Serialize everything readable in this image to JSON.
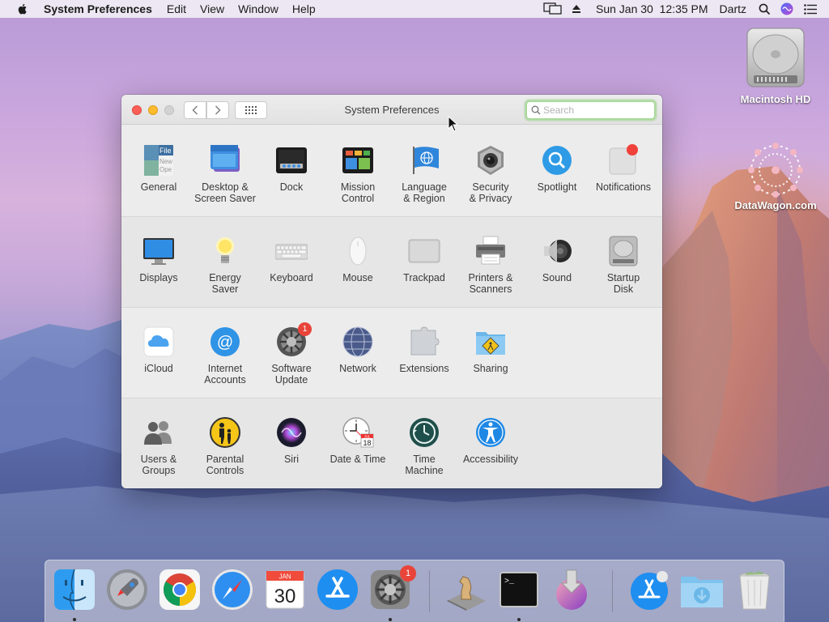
{
  "menubar": {
    "app_name": "System Preferences",
    "menus": [
      "Edit",
      "View",
      "Window",
      "Help"
    ],
    "clock": "Sun Jan 30  12:35 PM",
    "user": "Dartz"
  },
  "desktop": {
    "items": [
      {
        "label": "Macintosh HD",
        "icon": "hard-drive-icon"
      },
      {
        "label": "DataWagon.com",
        "icon": "datawagon-logo-icon"
      }
    ]
  },
  "window": {
    "title": "System Preferences",
    "search_placeholder": "Search",
    "sections": [
      {
        "panes": [
          {
            "label": "General",
            "icon": "general-icon"
          },
          {
            "label": "Desktop &\nScreen Saver",
            "icon": "desktop-screensaver-icon"
          },
          {
            "label": "Dock",
            "icon": "dock-icon"
          },
          {
            "label": "Mission\nControl",
            "icon": "mission-control-icon"
          },
          {
            "label": "Language\n& Region",
            "icon": "language-region-icon"
          },
          {
            "label": "Security\n& Privacy",
            "icon": "security-privacy-icon"
          },
          {
            "label": "Spotlight",
            "icon": "spotlight-icon"
          },
          {
            "label": "Notifications",
            "icon": "notifications-icon"
          }
        ]
      },
      {
        "panes": [
          {
            "label": "Displays",
            "icon": "displays-icon"
          },
          {
            "label": "Energy\nSaver",
            "icon": "energy-saver-icon"
          },
          {
            "label": "Keyboard",
            "icon": "keyboard-icon"
          },
          {
            "label": "Mouse",
            "icon": "mouse-icon"
          },
          {
            "label": "Trackpad",
            "icon": "trackpad-icon"
          },
          {
            "label": "Printers &\nScanners",
            "icon": "printers-scanners-icon"
          },
          {
            "label": "Sound",
            "icon": "sound-icon"
          },
          {
            "label": "Startup\nDisk",
            "icon": "startup-disk-icon"
          }
        ]
      },
      {
        "panes": [
          {
            "label": "iCloud",
            "icon": "icloud-icon"
          },
          {
            "label": "Internet\nAccounts",
            "icon": "internet-accounts-icon"
          },
          {
            "label": "Software\nUpdate",
            "icon": "software-update-icon",
            "badge": "1"
          },
          {
            "label": "Network",
            "icon": "network-icon"
          },
          {
            "label": "Extensions",
            "icon": "extensions-icon"
          },
          {
            "label": "Sharing",
            "icon": "sharing-icon"
          }
        ]
      },
      {
        "panes": [
          {
            "label": "Users &\nGroups",
            "icon": "users-groups-icon"
          },
          {
            "label": "Parental\nControls",
            "icon": "parental-controls-icon"
          },
          {
            "label": "Siri",
            "icon": "siri-icon"
          },
          {
            "label": "Date & Time",
            "icon": "date-time-icon"
          },
          {
            "label": "Time\nMachine",
            "icon": "time-machine-icon"
          },
          {
            "label": "Accessibility",
            "icon": "accessibility-icon"
          }
        ]
      }
    ],
    "calendar_icon_text": {
      "month": "JUL",
      "day": "18"
    }
  },
  "dock": {
    "calendar": {
      "month": "JAN",
      "day": "30"
    },
    "sysprefs_badge": "1",
    "terminal_prompt": ">_",
    "items": [
      "finder-icon",
      "launchpad-icon",
      "chrome-icon",
      "safari-icon",
      "calendar-icon",
      "app-store-icon",
      "system-preferences-icon",
      "chess-icon",
      "terminal-icon",
      "installer-icon",
      "app-store-download-icon",
      "downloads-folder-icon",
      "trash-icon"
    ]
  },
  "colors": {
    "accent": "#1e88e5",
    "badge": "#e8443a"
  }
}
